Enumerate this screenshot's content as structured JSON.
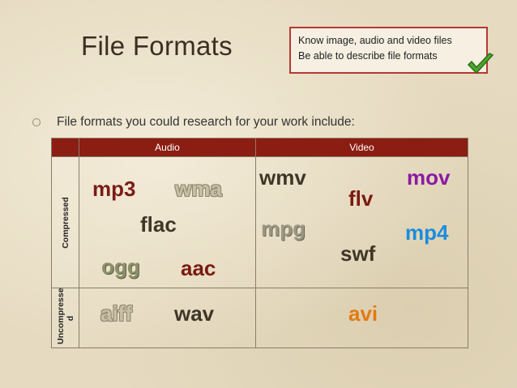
{
  "slide": {
    "title": "File Formats",
    "objectives": [
      "Know image, audio and video files",
      "Be able to describe file formats"
    ],
    "bullet": "File formats you could research for your work include:"
  },
  "table": {
    "headers": [
      "Audio",
      "Video"
    ],
    "row_labels": [
      "Compressed",
      "Uncompresse d"
    ],
    "compressed_audio": [
      "mp3",
      "wma",
      "flac",
      "ogg",
      "aac"
    ],
    "compressed_video": [
      "wmv",
      "flv",
      "mov",
      "mpg",
      "swf",
      "mp4"
    ],
    "uncompressed_audio": [
      "aiff",
      "wav"
    ],
    "uncompressed_video": [
      "avi"
    ]
  },
  "colors": {
    "header_bg": "#8b1d12",
    "objective_border": "#b23a32",
    "check": "#4aa82c"
  },
  "icons": [
    "checkmark-icon",
    "bullet-circle-icon"
  ]
}
